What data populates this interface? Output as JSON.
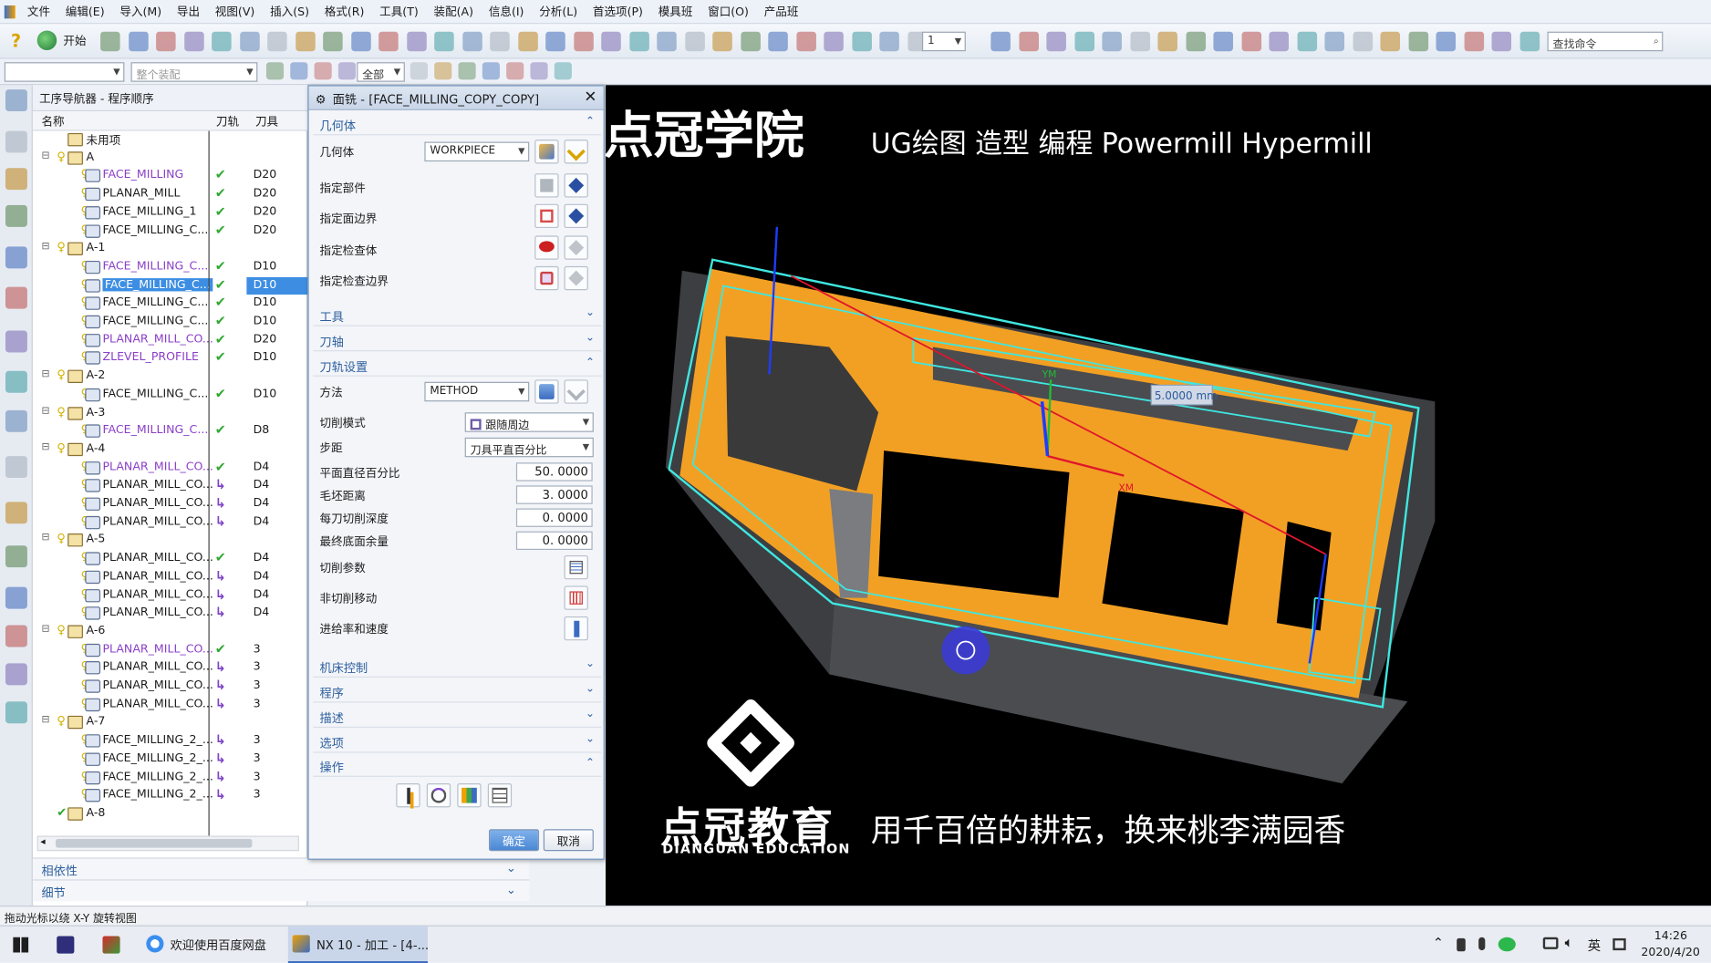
{
  "menubar": {
    "items": [
      "文件",
      "编辑(E)",
      "导入(M)",
      "导出",
      "视图(V)",
      "插入(S)",
      "格式(R)",
      "工具(T)",
      "装配(A)",
      "信息(I)",
      "分析(L)",
      "首选项(P)",
      "模具班",
      "窗口(O)",
      "产品班"
    ]
  },
  "toolbar": {
    "help_icon": "help-icon",
    "start_label": "开始",
    "layer_value": "1",
    "search_placeholder": "查找命令",
    "filter_all": "全部",
    "assembly_placeholder": "整个装配"
  },
  "navigator": {
    "title": "工序导航器 - 程序顺序",
    "columns": [
      "名称",
      "刀轨",
      "刀具"
    ],
    "rows": [
      {
        "level": 0,
        "type": "folder",
        "name": "未用项",
        "status": "",
        "tool": ""
      },
      {
        "level": 0,
        "type": "folder",
        "name": "A",
        "status": "",
        "tool": "",
        "expanded": true
      },
      {
        "level": 1,
        "type": "op",
        "name": "FACE_MILLING",
        "status": "ok",
        "tool": "D20",
        "color": "purple"
      },
      {
        "level": 1,
        "type": "op",
        "name": "PLANAR_MILL",
        "status": "ok",
        "tool": "D20",
        "color": "black"
      },
      {
        "level": 1,
        "type": "op",
        "name": "FACE_MILLING_1",
        "status": "ok",
        "tool": "D20",
        "color": "black"
      },
      {
        "level": 1,
        "type": "op",
        "name": "FACE_MILLING_C...",
        "status": "ok",
        "tool": "D20",
        "color": "black"
      },
      {
        "level": 0,
        "type": "folder",
        "name": "A-1",
        "status": "",
        "tool": "",
        "expanded": true
      },
      {
        "level": 1,
        "type": "op",
        "name": "FACE_MILLING_C...",
        "status": "ok",
        "tool": "D10",
        "color": "purple"
      },
      {
        "level": 1,
        "type": "op",
        "name": "FACE_MILLING_C...",
        "status": "ok",
        "tool": "D10",
        "color": "black",
        "selected": true
      },
      {
        "level": 1,
        "type": "op",
        "name": "FACE_MILLING_C...",
        "status": "ok",
        "tool": "D10",
        "color": "black"
      },
      {
        "level": 1,
        "type": "op",
        "name": "FACE_MILLING_C...",
        "status": "ok",
        "tool": "D10",
        "color": "black"
      },
      {
        "level": 1,
        "type": "op",
        "name": "PLANAR_MILL_CO...",
        "status": "ok",
        "tool": "D20",
        "color": "purple"
      },
      {
        "level": 1,
        "type": "op",
        "name": "ZLEVEL_PROFILE",
        "status": "ok",
        "tool": "D10",
        "color": "purple"
      },
      {
        "level": 0,
        "type": "folder",
        "name": "A-2",
        "status": "",
        "tool": "",
        "expanded": true
      },
      {
        "level": 1,
        "type": "op",
        "name": "FACE_MILLING_C...",
        "status": "ok",
        "tool": "D10",
        "color": "black"
      },
      {
        "level": 0,
        "type": "folder",
        "name": "A-3",
        "status": "",
        "tool": "",
        "expanded": true
      },
      {
        "level": 1,
        "type": "op",
        "name": "FACE_MILLING_C...",
        "status": "ok",
        "tool": "D8",
        "color": "purple"
      },
      {
        "level": 0,
        "type": "folder",
        "name": "A-4",
        "status": "",
        "tool": "",
        "expanded": true
      },
      {
        "level": 1,
        "type": "op",
        "name": "PLANAR_MILL_CO...",
        "status": "ok",
        "tool": "D4",
        "color": "purple"
      },
      {
        "level": 1,
        "type": "op",
        "name": "PLANAR_MILL_CO...",
        "status": "regen",
        "tool": "D4",
        "color": "black"
      },
      {
        "level": 1,
        "type": "op",
        "name": "PLANAR_MILL_CO...",
        "status": "regen",
        "tool": "D4",
        "color": "black"
      },
      {
        "level": 1,
        "type": "op",
        "name": "PLANAR_MILL_CO...",
        "status": "regen",
        "tool": "D4",
        "color": "black"
      },
      {
        "level": 0,
        "type": "folder",
        "name": "A-5",
        "status": "",
        "tool": "",
        "expanded": true
      },
      {
        "level": 1,
        "type": "op",
        "name": "PLANAR_MILL_CO...",
        "status": "ok",
        "tool": "D4",
        "color": "black"
      },
      {
        "level": 1,
        "type": "op",
        "name": "PLANAR_MILL_CO...",
        "status": "regen",
        "tool": "D4",
        "color": "black"
      },
      {
        "level": 1,
        "type": "op",
        "name": "PLANAR_MILL_CO...",
        "status": "regen",
        "tool": "D4",
        "color": "black"
      },
      {
        "level": 1,
        "type": "op",
        "name": "PLANAR_MILL_CO...",
        "status": "regen",
        "tool": "D4",
        "color": "black"
      },
      {
        "level": 0,
        "type": "folder",
        "name": "A-6",
        "status": "",
        "tool": "",
        "expanded": true
      },
      {
        "level": 1,
        "type": "op",
        "name": "PLANAR_MILL_CO...",
        "status": "ok",
        "tool": "3",
        "color": "purple"
      },
      {
        "level": 1,
        "type": "op",
        "name": "PLANAR_MILL_CO...",
        "status": "regen",
        "tool": "3",
        "color": "black"
      },
      {
        "level": 1,
        "type": "op",
        "name": "PLANAR_MILL_CO...",
        "status": "regen",
        "tool": "3",
        "color": "black"
      },
      {
        "level": 1,
        "type": "op",
        "name": "PLANAR_MILL_CO...",
        "status": "regen",
        "tool": "3",
        "color": "black"
      },
      {
        "level": 0,
        "type": "folder",
        "name": "A-7",
        "status": "",
        "tool": "",
        "expanded": true
      },
      {
        "level": 1,
        "type": "op",
        "name": "FACE_MILLING_2_...",
        "status": "regen",
        "tool": "3",
        "color": "black"
      },
      {
        "level": 1,
        "type": "op",
        "name": "FACE_MILLING_2_...",
        "status": "regen",
        "tool": "3",
        "color": "black"
      },
      {
        "level": 1,
        "type": "op",
        "name": "FACE_MILLING_2_...",
        "status": "regen",
        "tool": "3",
        "color": "black"
      },
      {
        "level": 1,
        "type": "op",
        "name": "FACE_MILLING_2_...",
        "status": "regen",
        "tool": "3",
        "color": "black"
      },
      {
        "level": 0,
        "type": "folder",
        "name": "A-8",
        "status": "ok",
        "tool": ""
      }
    ],
    "footer": [
      "相依性",
      "细节"
    ]
  },
  "dialog": {
    "title": "面铣 - [FACE_MILLING_COPY_COPY]",
    "sections": {
      "geometry": "几何体",
      "tool": "工具",
      "axis": "刀轴",
      "path": "刀轨设置",
      "machine": "机床控制",
      "program": "程序",
      "description": "描述",
      "options": "选项",
      "actions": "操作"
    },
    "geometry_label": "几何体",
    "geometry_value": "WORKPIECE",
    "specify_part": "指定部件",
    "specify_face_boundary": "指定面边界",
    "specify_check_body": "指定检查体",
    "specify_check_boundary": "指定检查边界",
    "method_label": "方法",
    "method_value": "METHOD",
    "cut_pattern_label": "切削模式",
    "cut_pattern_value": "跟随周边",
    "stepover_label": "步距",
    "stepover_value": "刀具平直百分比",
    "flat_diameter_label": "平面直径百分比",
    "flat_diameter_value": "50. 0000",
    "blank_distance_label": "毛坯距离",
    "blank_distance_value": "3. 0000",
    "depth_per_cut_label": "每刀切削深度",
    "depth_per_cut_value": "0. 0000",
    "final_floor_stock_label": "最终底面余量",
    "final_floor_stock_value": "0. 0000",
    "cutting_params": "切削参数",
    "non_cutting_moves": "非切削移动",
    "feeds_speeds": "进给率和速度",
    "ok_label": "确定",
    "cancel_label": "取消"
  },
  "viewport": {
    "title_main": "点冠学院",
    "title_sub": "UG绘图 造型 编程 Powermill Hypermill",
    "dimension_label": "5.0000 mm",
    "axis_labels": [
      "XM",
      "YM"
    ],
    "logo_cn": "点冠教育",
    "logo_en": "DIANGUAN EDUCATION",
    "slogan": "用千百倍的耕耘，换来桃李满园香",
    "colors": {
      "part": "#f2a024",
      "toolpath": "#3fe7e0",
      "vector": "#e0162b"
    }
  },
  "statusbar": {
    "text": "拖动光标以绕 X-Y 旋转视图"
  },
  "taskbar": {
    "items": [
      "欢迎使用百度网盘",
      "NX 10 - 加工 - [4-..."
    ],
    "tray_lang": "英",
    "time": "14:26",
    "date": "2020/4/20"
  }
}
